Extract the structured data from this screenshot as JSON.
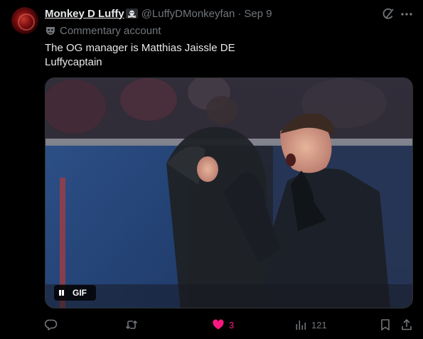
{
  "author": {
    "display_name": "Monkey D Luffy",
    "handle": "@LuffyDMonkeyfan",
    "separator": "·",
    "time": "Sep 9",
    "badge_icon": "pirate-flag-icon"
  },
  "label": {
    "icon": "mask-icon",
    "text": "Commentary account"
  },
  "tweet": {
    "line1": "The OG manager is Matthias Jaissle DE",
    "line2": "Luffycaptain"
  },
  "media": {
    "type": "gif",
    "badge_label": "GIF",
    "control_icon": "pause-icon"
  },
  "actions": {
    "reply_count": "",
    "retweet_count": "",
    "like_count": "3",
    "views_count": "121"
  },
  "colors": {
    "background": "#000000",
    "text": "#e7e9ea",
    "muted": "#71767b",
    "like": "#f91880"
  }
}
